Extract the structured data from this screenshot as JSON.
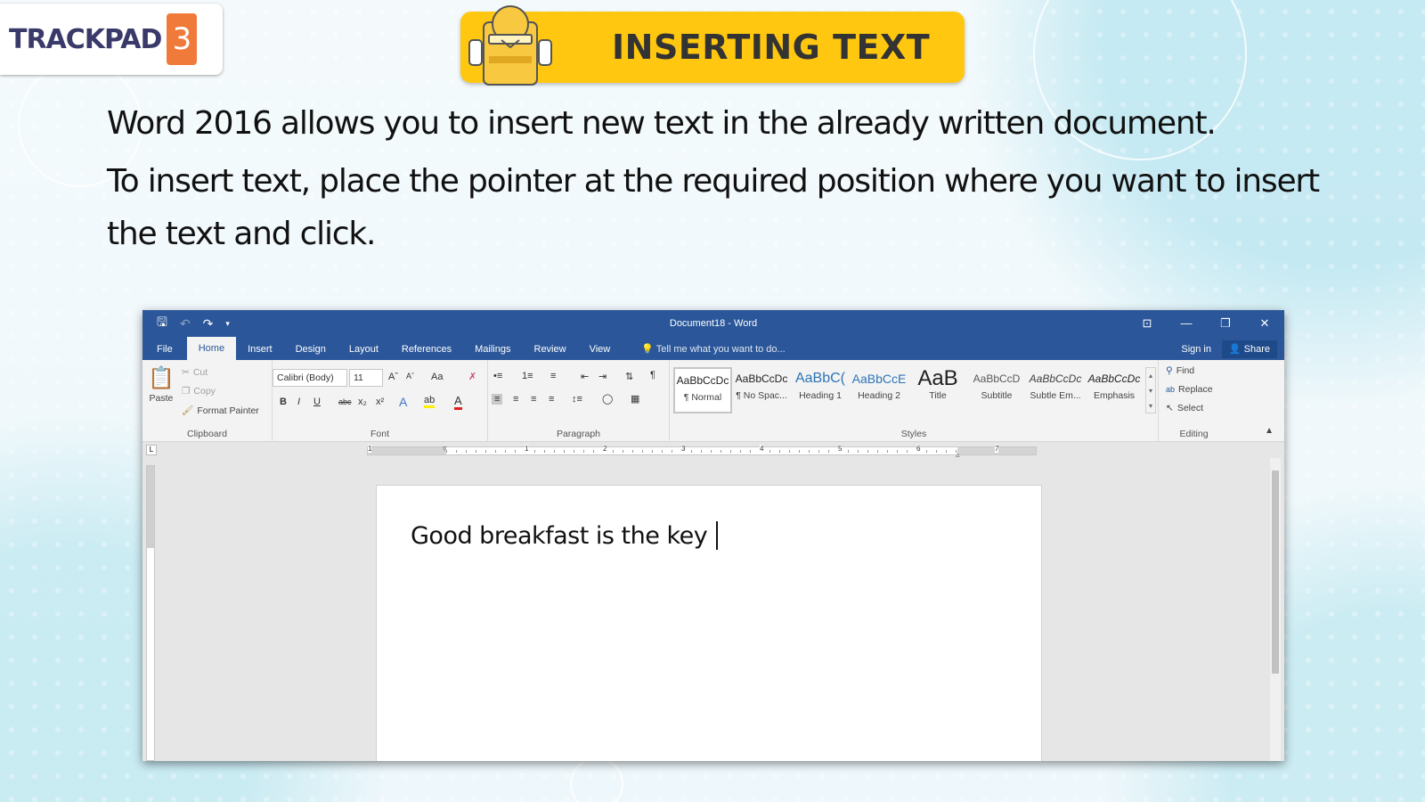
{
  "logo": {
    "text": "TRACKPAD",
    "number": "3"
  },
  "banner": {
    "title": "INSERTING TEXT"
  },
  "body": {
    "line1": "Word 2016 allows you to insert new text in the already written document.",
    "line2": "To insert text, place the pointer at the required position where you want to insert",
    "line3": "the text and click."
  },
  "word": {
    "title": "Document18 - Word",
    "window_controls": {
      "ribbon_display": "⊡",
      "minimize": "—",
      "restore": "❐",
      "close": "✕"
    },
    "tabs": [
      "File",
      "Home",
      "Insert",
      "Design",
      "Layout",
      "References",
      "Mailings",
      "Review",
      "View"
    ],
    "active_tab": "Home",
    "tell_me": "Tell me what you want to do...",
    "sign_in": "Sign in",
    "share": "Share",
    "clipboard": {
      "paste": "Paste",
      "cut": "Cut",
      "copy": "Copy",
      "format_painter": "Format Painter",
      "label": "Clipboard"
    },
    "font": {
      "name": "Calibri (Body)",
      "size": "11",
      "change_case": "Aa",
      "label": "Font"
    },
    "paragraph": {
      "label": "Paragraph"
    },
    "styles": {
      "label": "Styles",
      "items": [
        {
          "preview": "AaBbCcDc",
          "name": "¶ Normal",
          "color": "#222222"
        },
        {
          "preview": "AaBbCcDc",
          "name": "¶ No Spac...",
          "color": "#222222"
        },
        {
          "preview": "AaBbC(",
          "name": "Heading 1",
          "color": "#2e74b5"
        },
        {
          "preview": "AaBbCcE",
          "name": "Heading 2",
          "color": "#2e74b5"
        },
        {
          "preview": "AaB",
          "name": "Title",
          "color": "#222222"
        },
        {
          "preview": "AaBbCcD",
          "name": "Subtitle",
          "color": "#595959"
        },
        {
          "preview": "AaBbCcDc",
          "name": "Subtle Em...",
          "color": "#404040"
        },
        {
          "preview": "AaBbCcDc",
          "name": "Emphasis",
          "color": "#222222"
        }
      ]
    },
    "editing": {
      "find": "Find",
      "replace": "Replace",
      "select": "Select",
      "label": "Editing"
    },
    "ruler_numbers": [
      "1",
      "1",
      "2",
      "3",
      "4",
      "5",
      "6",
      "7"
    ],
    "document_text": "Good breakfast is the key"
  }
}
